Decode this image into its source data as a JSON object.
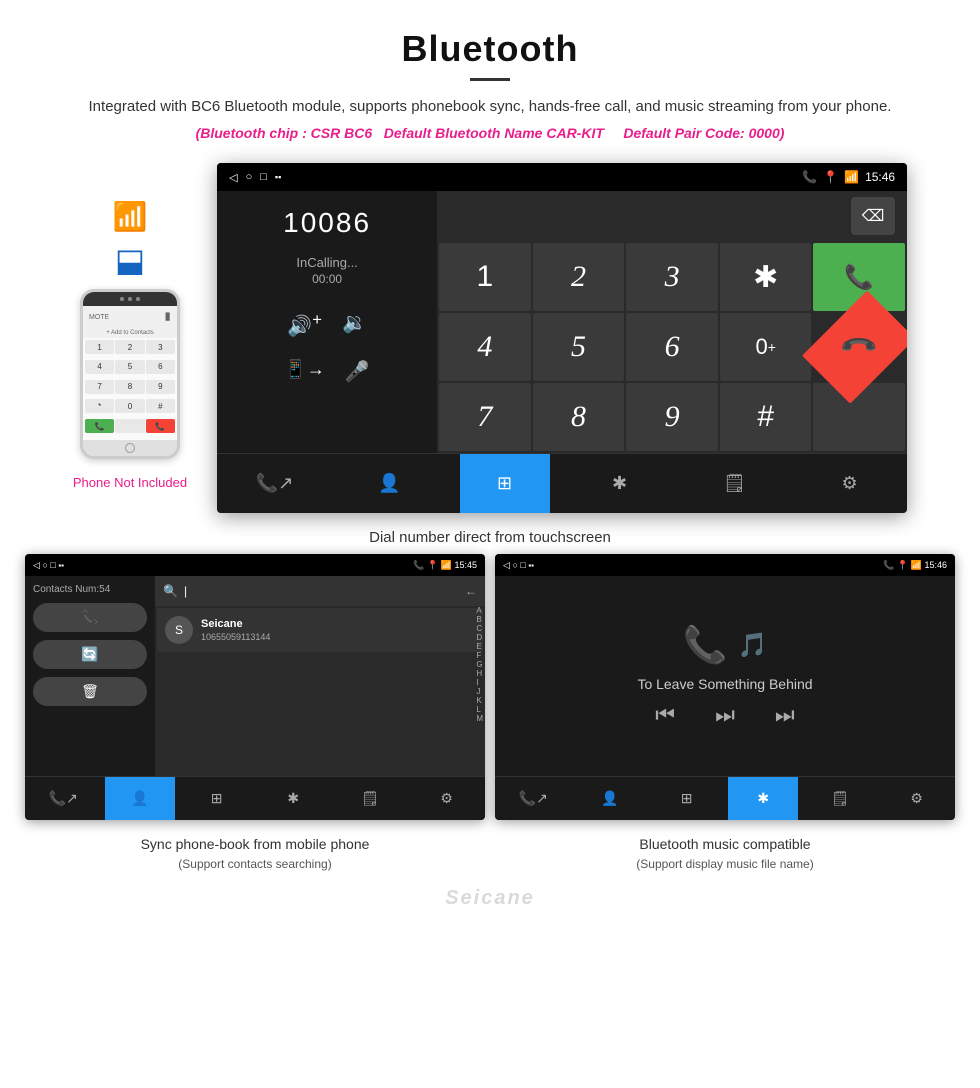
{
  "header": {
    "title": "Bluetooth",
    "description": "Integrated with BC6 Bluetooth module, supports phonebook sync, hands-free call, and music streaming from your phone.",
    "highlight1": "(Bluetooth chip : CSR BC6",
    "highlight2": "Default Bluetooth Name CAR-KIT",
    "highlight3": "Default Pair Code: 0000)"
  },
  "phone_illustration": {
    "caption": "Phone Not Included",
    "keys": [
      "1",
      "2",
      "3",
      "4",
      "5",
      "6",
      "7",
      "8",
      "9",
      "*",
      "0",
      "#"
    ]
  },
  "dialer": {
    "status_bar": {
      "back_icon": "◁",
      "home_icon": "○",
      "apps_icon": "□",
      "signal_icon": "📶",
      "time": "15:46"
    },
    "number": "10086",
    "calling_label": "InCalling...",
    "timer": "00:00",
    "keys": [
      "1",
      "2",
      "3",
      "✱",
      "4",
      "5",
      "6",
      "0+",
      "7",
      "8",
      "9",
      "#"
    ],
    "vol_up": "🔊+",
    "vol_down": "🔊-",
    "keypad_label": "⌨",
    "mic_label": "🎤",
    "transfer_label": "📱",
    "call_icon": "📞",
    "end_icon": "📞"
  },
  "main_caption": "Dial number direct from touchscreen",
  "phonebook": {
    "status_bar_time": "15:45",
    "contacts_count": "Contacts Num:54",
    "search_placeholder": "|",
    "contact_name": "Seicane",
    "contact_phone": "10655059113144",
    "alpha_letters": [
      "A",
      "B",
      "C",
      "D",
      "E",
      "F",
      "G",
      "H",
      "I",
      "J",
      "K",
      "L",
      "M"
    ],
    "nav_items": [
      "📞",
      "👤",
      "⊞",
      "✱",
      "🗒",
      "⚙"
    ]
  },
  "music": {
    "status_bar_time": "15:46",
    "song_title": "To Leave Something Behind",
    "controls": [
      "⏮",
      "⏭",
      "⏭"
    ],
    "nav_items": [
      "📞",
      "👤",
      "⊞",
      "✱",
      "🗒",
      "⚙"
    ]
  },
  "captions": {
    "phonebook_main": "Sync phone-book from mobile phone",
    "phonebook_sub": "(Support contacts searching)",
    "music_main": "Bluetooth music compatible",
    "music_sub": "(Support display music file name)"
  },
  "watermark": "Seicane"
}
